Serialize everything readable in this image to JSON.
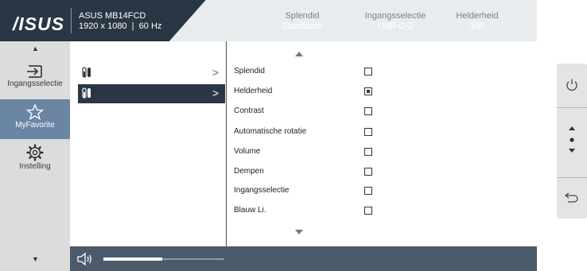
{
  "header": {
    "logo": "/ISUS",
    "model_name": "ASUS MB14FCD",
    "resolution": "1920 x 1080",
    "refresh_rate": "60 Hz",
    "stats": [
      {
        "label": "Splendid",
        "value": "Standaard"
      },
      {
        "label": "Ingangsselectie",
        "value": "USB-C-2"
      },
      {
        "label": "Helderheid",
        "value": "100"
      }
    ]
  },
  "sidebar": {
    "items": [
      {
        "label": "Ingangsselectie",
        "icon": "input-icon"
      },
      {
        "label": "MyFavorite",
        "icon": "star-icon",
        "active": true
      },
      {
        "label": "Instelling",
        "icon": "gear-icon"
      }
    ]
  },
  "submenu": {
    "items": [
      {
        "icon": "shortcut-1-icon",
        "active": false
      },
      {
        "icon": "shortcut-2-icon",
        "active": true
      }
    ]
  },
  "options": {
    "items": [
      {
        "label": "Splendid",
        "checked": false
      },
      {
        "label": "Helderheid",
        "checked": true
      },
      {
        "label": "Contrast",
        "checked": false
      },
      {
        "label": "Automatische rotatie",
        "checked": false
      },
      {
        "label": "Volume",
        "checked": false
      },
      {
        "label": "Dempen",
        "checked": false
      },
      {
        "label": "Ingangsselectie",
        "checked": false
      },
      {
        "label": "Blauw Li.",
        "checked": false
      }
    ]
  },
  "volume": {
    "level_fraction": 0.49
  },
  "right_panel": {
    "buttons": [
      "power-icon",
      "navigate-icon",
      "back-icon"
    ]
  },
  "colors": {
    "header_bg": "#2a3644",
    "active_bg": "#6b86a3",
    "bottom_bar": "#4b5a68"
  }
}
